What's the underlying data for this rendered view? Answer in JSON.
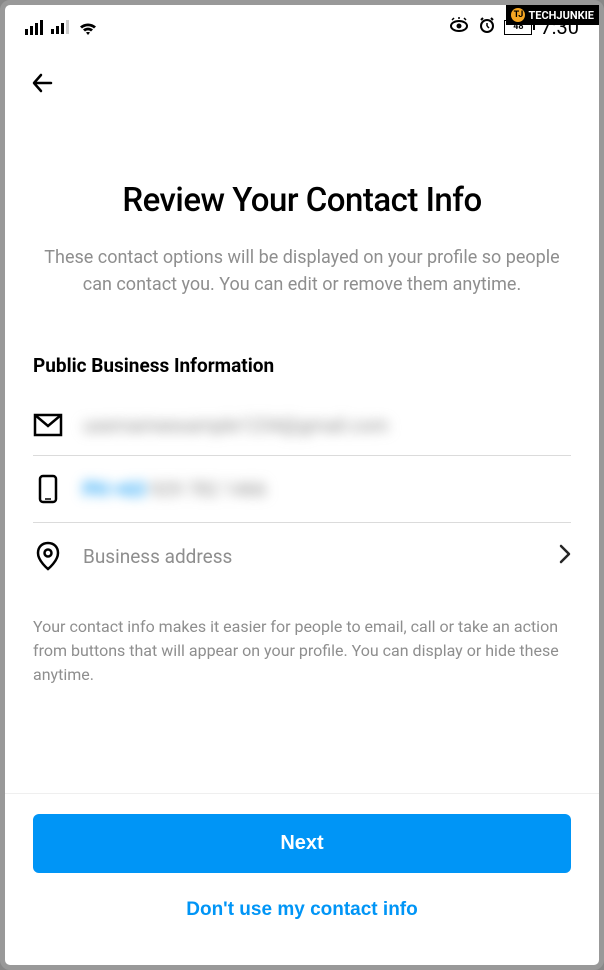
{
  "watermark": {
    "text": "TECHJUNKIE",
    "logo": "TJ"
  },
  "statusBar": {
    "battery": "48",
    "time": "7:30"
  },
  "page": {
    "title": "Review Your Contact Info",
    "subtitle": "These contact options will be displayed on your profile so people can contact you. You can edit or remove them anytime.",
    "sectionHeader": "Public Business Information",
    "email": {
      "value": "usernameexample1234@gmail.com"
    },
    "phone": {
      "prefix": "PH +63",
      "number": "929 782 1466"
    },
    "address": {
      "placeholder": "Business address"
    },
    "helperText": "Your contact info makes it easier for people to email, call or take an action from buttons that will appear on your profile. You can display or hide these anytime."
  },
  "actions": {
    "primary": "Next",
    "secondary": "Don't use my contact info"
  }
}
